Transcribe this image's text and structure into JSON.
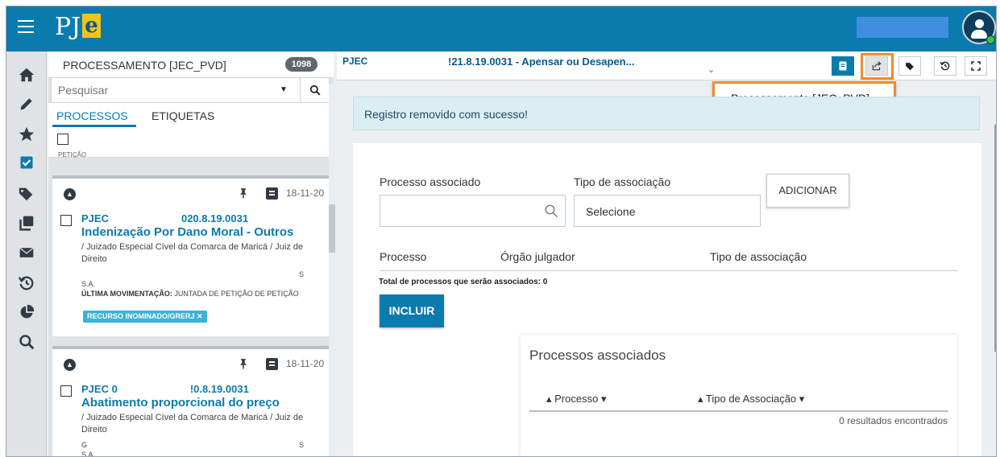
{
  "header": {
    "logo_text": "PJ",
    "logo_e": "e"
  },
  "sidebar": {
    "icons": [
      "home-icon",
      "pencil-icon",
      "star-icon",
      "checkbox-icon",
      "tags-icon",
      "copies-icon",
      "mail-icon",
      "history-icon",
      "pie-chart-icon",
      "search-icon"
    ]
  },
  "list": {
    "title": "PROCESSAMENTO [JEC_PVD]",
    "count": "1098",
    "search_placeholder": "Pesquisar",
    "tabs": [
      "PROCESSOS",
      "ETIQUETAS"
    ],
    "cut_text": "PETIÇÃO",
    "cards": [
      {
        "date": "18-11-20",
        "number_prefix": "PJEC",
        "number_suffix": "020.8.19.0031",
        "class": "Indenização Por Dano Moral - Outros",
        "orgao": "/ Juizado Especial Cível da Comarca de Maricá / Juiz de Direito",
        "party_suffix": "S",
        "party_line": "S.A.",
        "mov_label": "ÚLTIMA MOVIMENTAÇÃO:",
        "mov_text": "JUNTADA DE PETIÇÃO DE PETIÇÃO",
        "tag": "RECURSO INOMINADO/GRERJ ✕"
      },
      {
        "date": "18-11-20",
        "number_prefix": "PJEC 0",
        "number_suffix": "!0.8.19.0031",
        "class": "Abatimento proporcional do preço",
        "orgao": "/ Juizado Especial Cível da Comarca de Maricá / Juiz de Direito",
        "party_prefix": "G",
        "party_suffix": "S",
        "party_line": "S.A."
      }
    ]
  },
  "main": {
    "title_prefix": "PJEC",
    "title_text": "!21.8.19.0031 - Apensar ou Desapen...",
    "dropdown_item": "Processamento [JEC_PVD]",
    "alert": "Registro removido com sucesso!",
    "form": {
      "processo_label": "Processo associado",
      "tipo_label": "Tipo de associação",
      "select_value": "Selecione",
      "add_button": "ADICIONAR",
      "col_processo": "Processo",
      "col_orgao": "Órgão julgador",
      "col_tipo": "Tipo de associação",
      "total": "Total de processos que serão associados: 0",
      "incluir_button": "INCLUIR"
    },
    "assoc": {
      "title": "Processos associados",
      "col_processo": "Processo",
      "col_tipo": "Tipo de Associação",
      "results": "0 resultados encontrados"
    }
  },
  "colors": {
    "brand": "#0b7bad",
    "highlight": "#f08c2a",
    "tag": "#3bb2d8"
  }
}
